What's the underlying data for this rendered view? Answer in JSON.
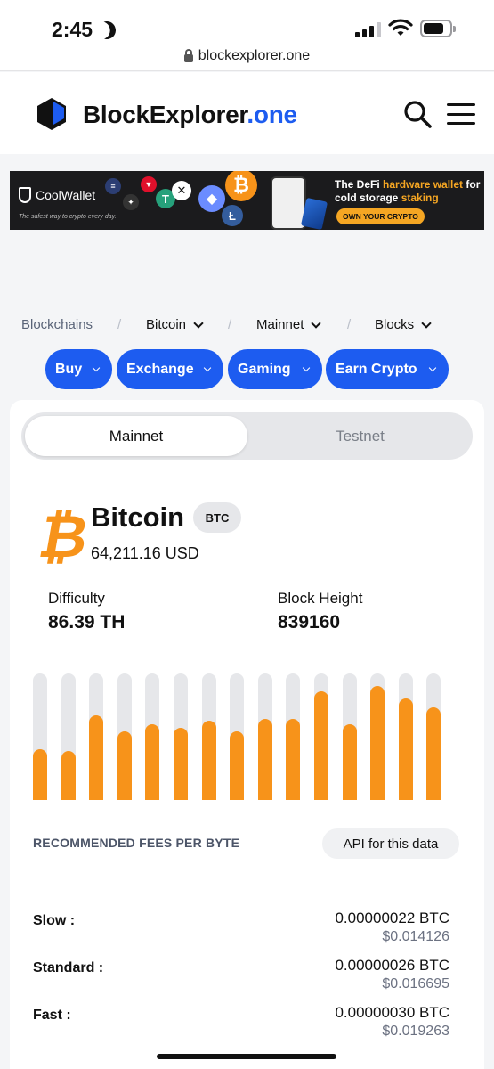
{
  "status_bar": {
    "time": "2:45",
    "url": "blockexplorer.one"
  },
  "header": {
    "brand_main": "BlockExplorer",
    "brand_suffix": ".one",
    "accent_color": "#1d5cf0"
  },
  "banner": {
    "brand": "CoolWallet",
    "tagline": "The safest way to crypto every day.",
    "headline_1": "The DeFi ",
    "headline_hl": "hardware wallet",
    "headline_2": " for cold storage ",
    "headline_hl2": "staking",
    "cta": "OWN YOUR CRYPTO"
  },
  "breadcrumb": {
    "items": [
      {
        "label": "Blockchains"
      },
      {
        "label": "Bitcoin"
      },
      {
        "label": "Mainnet"
      },
      {
        "label": "Blocks"
      }
    ],
    "separator": "/"
  },
  "pills": [
    {
      "label": "Buy"
    },
    {
      "label": "Exchange"
    },
    {
      "label": "Gaming"
    },
    {
      "label": "Earn Crypto"
    }
  ],
  "network_toggle": {
    "active": "Mainnet",
    "inactive": "Testnet"
  },
  "coin": {
    "name": "Bitcoin",
    "symbol": "BTC",
    "price": "64,211.16 USD",
    "brand_color": "#f7931a"
  },
  "stats": {
    "difficulty_label": "Difficulty",
    "difficulty_value": "86.39 TH",
    "height_label": "Block Height",
    "height_value": "839160"
  },
  "block_fill_levels": [
    0.4,
    0.39,
    0.67,
    0.54,
    0.6,
    0.57,
    0.63,
    0.54,
    0.64,
    0.64,
    0.86,
    0.6,
    0.9,
    0.8,
    0.73
  ],
  "fees": {
    "title": "RECOMMENDED FEES PER BYTE",
    "api_label": "API for this data",
    "rows": [
      {
        "name": "Slow :",
        "btc": "0.00000022 BTC",
        "usd": "$0.014126"
      },
      {
        "name": "Standard :",
        "btc": "0.00000026 BTC",
        "usd": "$0.016695"
      },
      {
        "name": "Fast :",
        "btc": "0.00000030 BTC",
        "usd": "$0.019263"
      }
    ]
  }
}
